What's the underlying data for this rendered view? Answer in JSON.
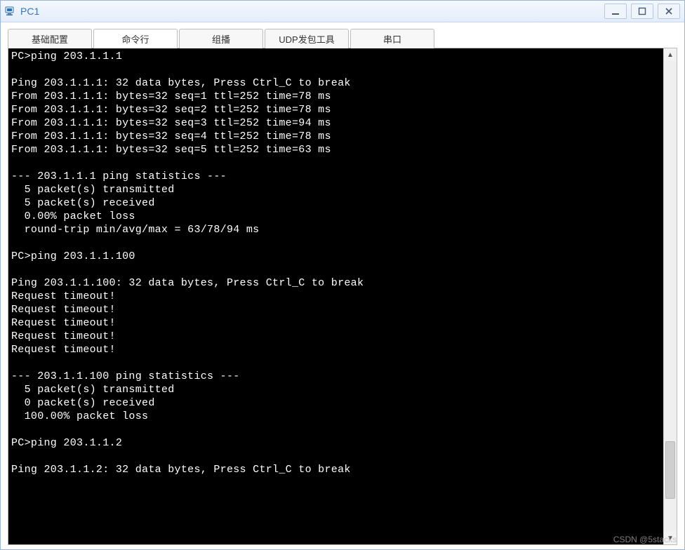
{
  "window": {
    "title": "PC1"
  },
  "tabs": [
    {
      "label": "基础配置",
      "active": false
    },
    {
      "label": "命令行",
      "active": true
    },
    {
      "label": "组播",
      "active": false
    },
    {
      "label": "UDP发包工具",
      "active": false
    },
    {
      "label": "串口",
      "active": false
    }
  ],
  "terminal": {
    "lines": [
      "PC>ping 203.1.1.1",
      "",
      "Ping 203.1.1.1: 32 data bytes, Press Ctrl_C to break",
      "From 203.1.1.1: bytes=32 seq=1 ttl=252 time=78 ms",
      "From 203.1.1.1: bytes=32 seq=2 ttl=252 time=78 ms",
      "From 203.1.1.1: bytes=32 seq=3 ttl=252 time=94 ms",
      "From 203.1.1.1: bytes=32 seq=4 ttl=252 time=78 ms",
      "From 203.1.1.1: bytes=32 seq=5 ttl=252 time=63 ms",
      "",
      "--- 203.1.1.1 ping statistics ---",
      "  5 packet(s) transmitted",
      "  5 packet(s) received",
      "  0.00% packet loss",
      "  round-trip min/avg/max = 63/78/94 ms",
      "",
      "PC>ping 203.1.1.100",
      "",
      "Ping 203.1.1.100: 32 data bytes, Press Ctrl_C to break",
      "Request timeout!",
      "Request timeout!",
      "Request timeout!",
      "Request timeout!",
      "Request timeout!",
      "",
      "--- 203.1.1.100 ping statistics ---",
      "  5 packet(s) transmitted",
      "  0 packet(s) received",
      "  100.00% packet loss",
      "",
      "PC>ping 203.1.1.2",
      "",
      "Ping 203.1.1.2: 32 data bytes, Press Ctrl_C to break"
    ]
  },
  "watermark": "CSDN @5stacks"
}
